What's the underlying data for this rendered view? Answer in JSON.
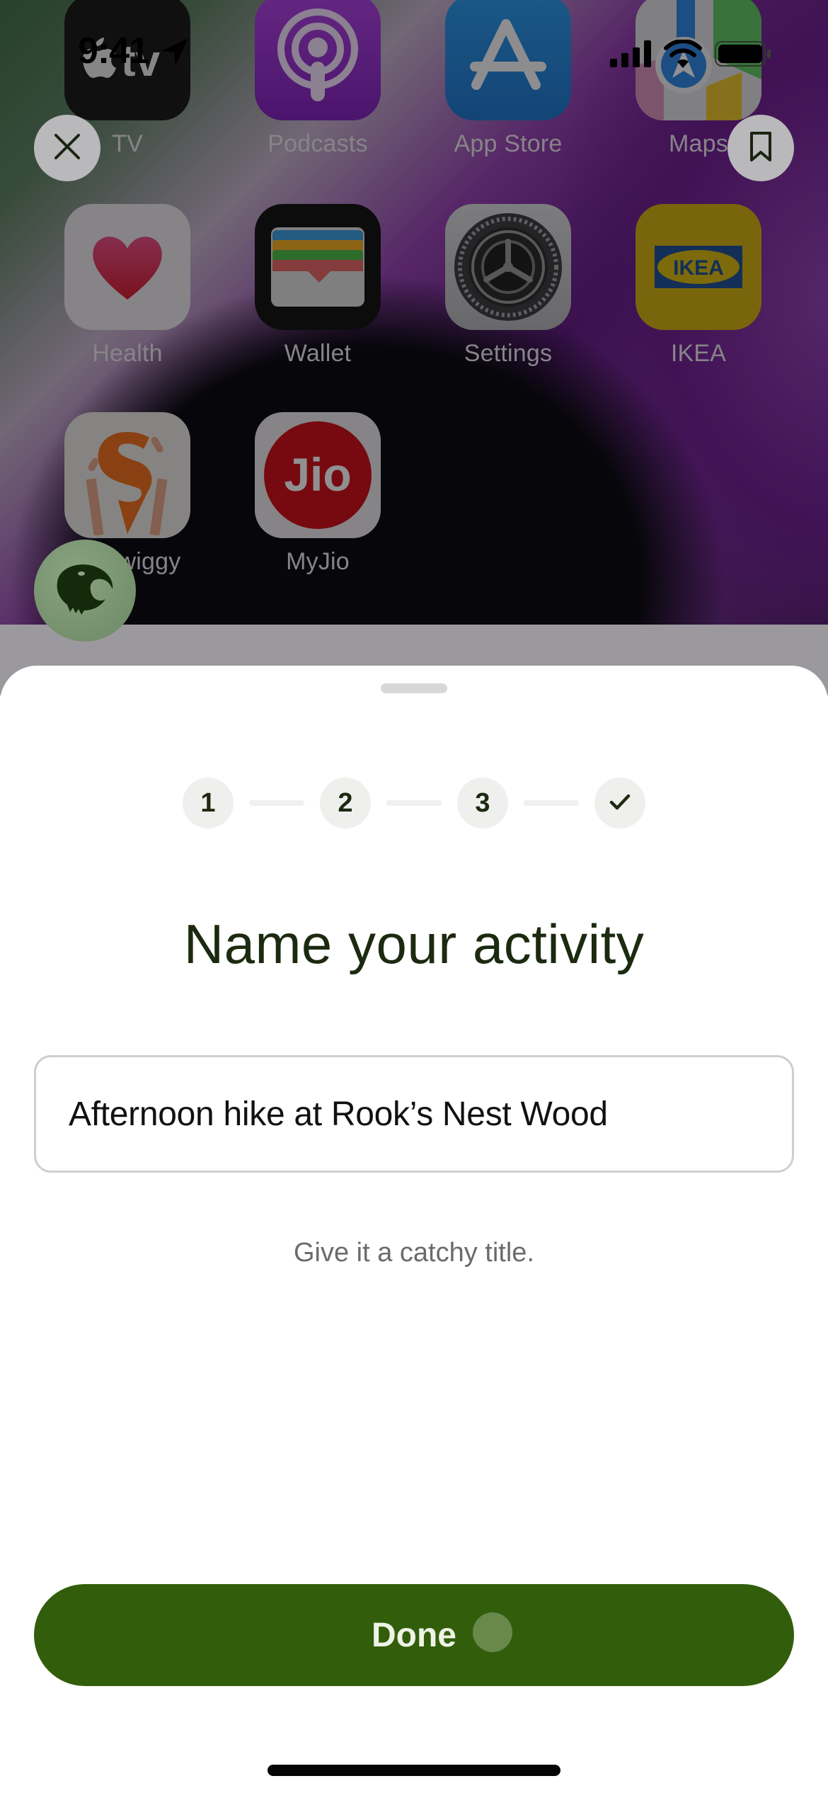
{
  "status_bar": {
    "time": "9:41",
    "icons": [
      "location-arrow-icon",
      "cellular-signal-icon",
      "wifi-icon",
      "battery-icon"
    ]
  },
  "home_screen": {
    "apps": [
      {
        "label": "TV",
        "icon": "apple-tv-icon"
      },
      {
        "label": "Podcasts",
        "icon": "podcasts-icon"
      },
      {
        "label": "App Store",
        "icon": "app-store-icon"
      },
      {
        "label": "Maps",
        "icon": "maps-icon"
      },
      {
        "label": "Health",
        "icon": "health-heart-icon"
      },
      {
        "label": "Wallet",
        "icon": "wallet-icon"
      },
      {
        "label": "Settings",
        "icon": "settings-gear-icon"
      },
      {
        "label": "IKEA",
        "icon": "ikea-icon"
      },
      {
        "label": "Swiggy",
        "icon": "swiggy-icon"
      },
      {
        "label": "MyJio",
        "icon": "jio-icon"
      }
    ],
    "ikea_logo_text": "IKEA",
    "jio_logo_text": "Jio"
  },
  "overlay_controls": {
    "close_icon": "close-icon",
    "bookmark_icon": "bookmark-icon",
    "avatar_icon": "eagle-avatar-icon"
  },
  "sheet": {
    "steps": [
      {
        "label": "1"
      },
      {
        "label": "2"
      },
      {
        "label": "3"
      },
      {
        "label": "✓",
        "icon": "checkmark-icon"
      }
    ],
    "title": "Name your activity",
    "input_value": "Afternoon hike at Rook’s Nest Wood",
    "hint": "Give it a catchy title.",
    "done_label": "Done"
  },
  "colors": {
    "accent_green": "#325e0b",
    "title_text": "#1c2a10",
    "hint_text": "#6b6b6b",
    "step_bg": "#efefed"
  }
}
